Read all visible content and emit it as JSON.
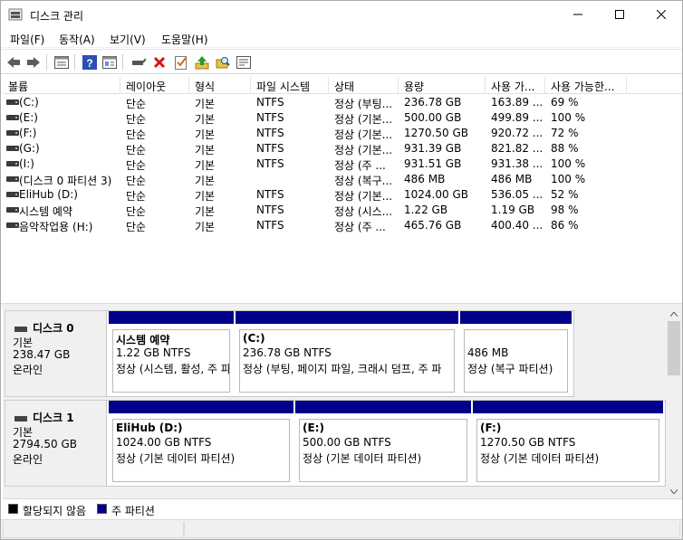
{
  "window": {
    "title": "디스크 관리"
  },
  "menu": [
    {
      "label": "파일(F)"
    },
    {
      "label": "동작(A)"
    },
    {
      "label": "보기(V)"
    },
    {
      "label": "도움말(H)"
    }
  ],
  "toolbar": {
    "icons": [
      "back-icon",
      "forward-icon",
      "properties-list-icon",
      "help-icon",
      "console-tree-icon",
      "connect-drive-icon",
      "delete-icon",
      "check-properties-icon",
      "import-up-icon",
      "search-folder-icon",
      "rescan-icon"
    ]
  },
  "list": {
    "columns": [
      "볼륨",
      "레이아웃",
      "형식",
      "파일 시스템",
      "상태",
      "용량",
      "사용 가...",
      "사용 가능한..."
    ],
    "rows": [
      [
        "(C:)",
        "단순",
        "기본",
        "NTFS",
        "정상 (부팅...",
        "236.78 GB",
        "163.89 ...",
        "69 %"
      ],
      [
        "(E:)",
        "단순",
        "기본",
        "NTFS",
        "정상 (기본...",
        "500.00 GB",
        "499.89 ...",
        "100 %"
      ],
      [
        "(F:)",
        "단순",
        "기본",
        "NTFS",
        "정상 (기본...",
        "1270.50 GB",
        "920.72 ...",
        "72 %"
      ],
      [
        "(G:)",
        "단순",
        "기본",
        "NTFS",
        "정상 (기본...",
        "931.39 GB",
        "821.82 ...",
        "88 %"
      ],
      [
        "(I:)",
        "단순",
        "기본",
        "NTFS",
        "정상 (주 ...",
        "931.51 GB",
        "931.38 ...",
        "100 %"
      ],
      [
        "(디스크 0 파티션 3)",
        "단순",
        "기본",
        "",
        "정상 (복구...",
        "486 MB",
        "486 MB",
        "100 %"
      ],
      [
        "EliHub (D:)",
        "단순",
        "기본",
        "NTFS",
        "정상 (기본...",
        "1024.00 GB",
        "536.05 ...",
        "52 %"
      ],
      [
        "시스템 예약",
        "단순",
        "기본",
        "NTFS",
        "정상 (시스...",
        "1.22 GB",
        "1.19 GB",
        "98 %"
      ],
      [
        "음악작업용 (H:)",
        "단순",
        "기본",
        "NTFS",
        "정상 (주 ...",
        "465.76 GB",
        "400.40 ...",
        "86 %"
      ]
    ]
  },
  "disks": [
    {
      "name": "디스크 0",
      "type": "기본",
      "size": "238.47 GB",
      "status": "온라인",
      "partitions": [
        {
          "name": "시스템 예약",
          "size": "1.22 GB NTFS",
          "status": "정상 (시스템, 활성, 주 파"
        },
        {
          "name": "(C:)",
          "size": "236.78 GB NTFS",
          "status": "정상 (부팅, 페이지 파일, 크래시 덤프, 주 파"
        },
        {
          "name": "",
          "size": "486 MB",
          "status": "정상 (복구 파티션)"
        }
      ]
    },
    {
      "name": "디스크 1",
      "type": "기본",
      "size": "2794.50 GB",
      "status": "온라인",
      "partitions": [
        {
          "name": "EliHub  (D:)",
          "size": "1024.00 GB NTFS",
          "status": "정상 (기본 데이터 파티션)"
        },
        {
          "name": "(E:)",
          "size": "500.00 GB NTFS",
          "status": "정상 (기본 데이터 파티션)"
        },
        {
          "name": "(F:)",
          "size": "1270.50 GB NTFS",
          "status": "정상 (기본 데이터 파티션)"
        }
      ]
    }
  ],
  "legend": [
    {
      "label": "할당되지 않음",
      "color": "#000000"
    },
    {
      "label": "주 파티션",
      "color": "#00008b"
    }
  ],
  "colors": {
    "primary_partition": "#00008b",
    "unallocated": "#000000"
  }
}
